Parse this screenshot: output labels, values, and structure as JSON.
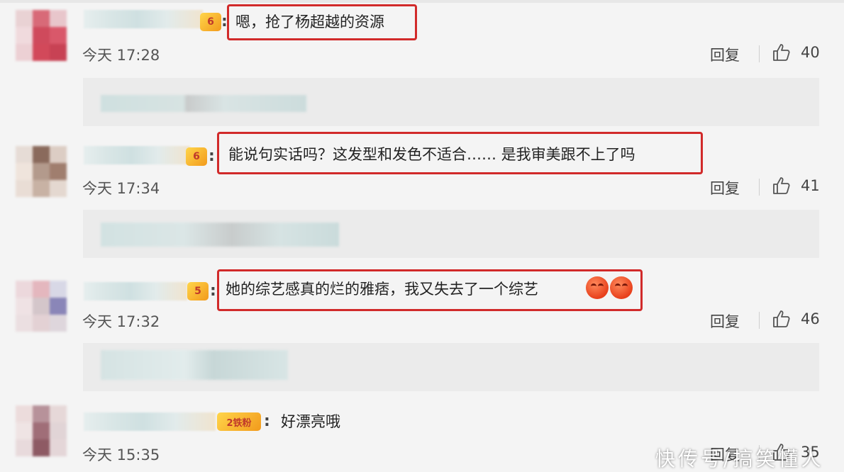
{
  "comments": [
    {
      "text": "嗯，抢了杨超越的资源",
      "time": "今天 17:28",
      "reply": "回复",
      "likes": "40",
      "badge": "6"
    },
    {
      "text": "能说句实话吗？这发型和发色不适合…… 是我审美跟不上了吗",
      "time": "今天 17:34",
      "reply": "回复",
      "likes": "41",
      "badge": "6"
    },
    {
      "text": "她的综艺感真的烂的雅痞，我又失去了一个综艺",
      "time": "今天 17:32",
      "reply": "回复",
      "likes": "46",
      "badge": "5"
    },
    {
      "text": "好漂亮哦",
      "time": "今天 15:35",
      "reply": "回复",
      "likes": "35",
      "badge": "2铁粉"
    }
  ],
  "watermark": "快传号/搞笑懂人",
  "colors": {
    "highlight": "#d12a2a",
    "background": "#f4f4f4",
    "badge": "#f29a1c"
  },
  "icons": [
    "thumbs-up-icon",
    "fire-emoji-icon",
    "fan-badge-icon"
  ]
}
